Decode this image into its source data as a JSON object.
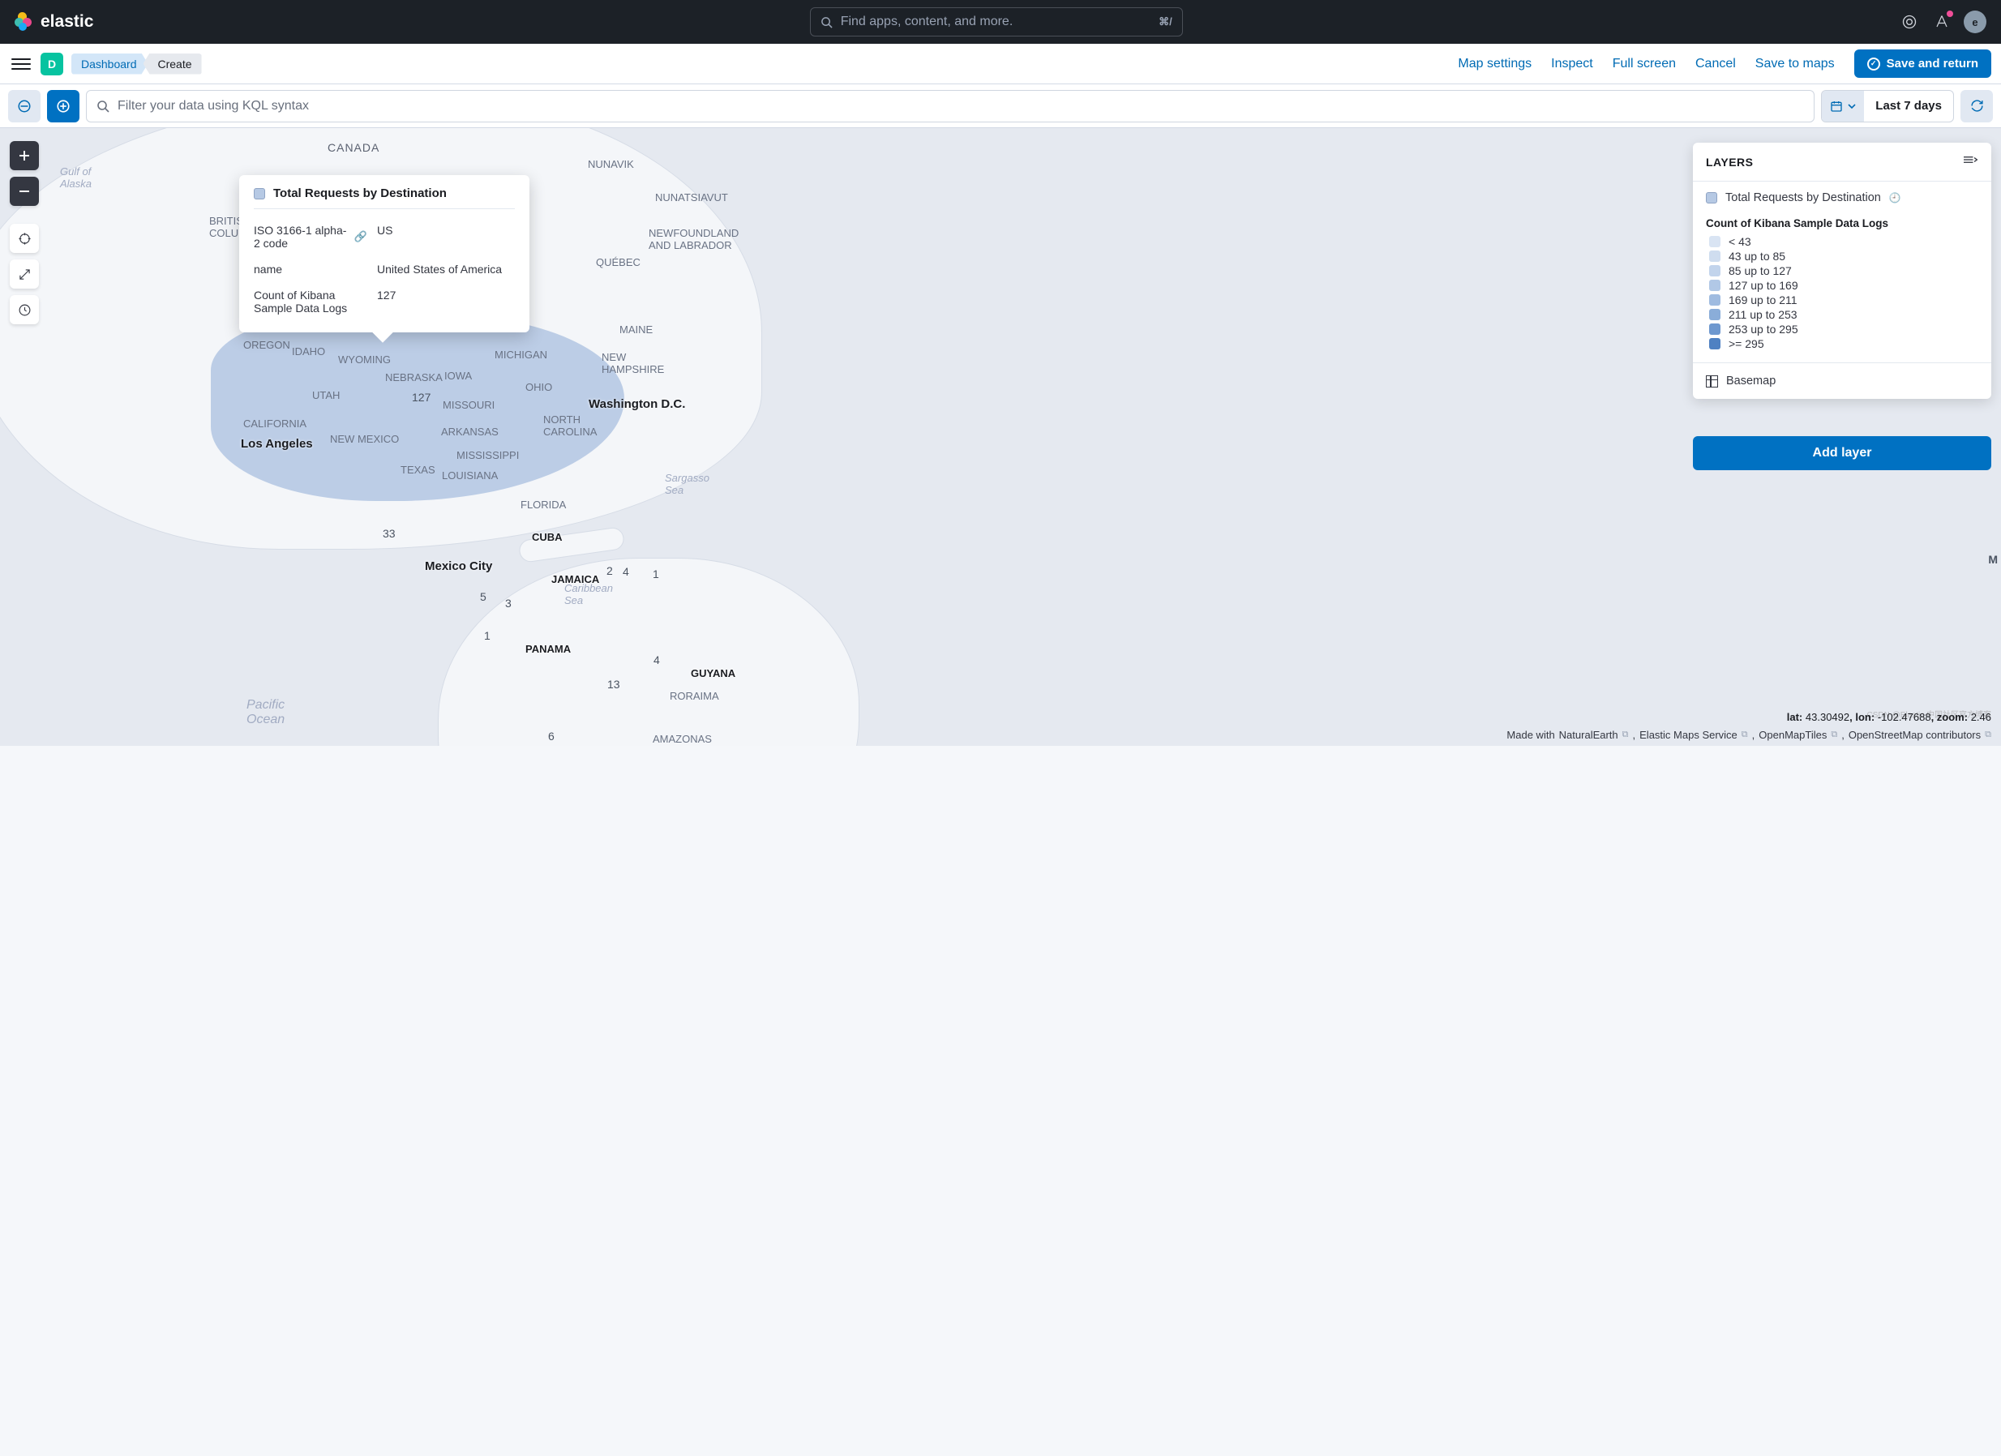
{
  "top": {
    "brand": "elastic",
    "search_placeholder": "Find apps, content, and more.",
    "shortcut": "⌘/",
    "avatar": "e"
  },
  "subbar": {
    "d_tag": "D",
    "crumbs": [
      "Dashboard",
      "Create"
    ],
    "links": [
      "Map settings",
      "Inspect",
      "Full screen",
      "Cancel",
      "Save to maps"
    ],
    "primary": "Save and return"
  },
  "query": {
    "placeholder": "Filter your data using KQL syntax",
    "timerange": "Last 7 days"
  },
  "tooltip": {
    "title": "Total Requests by Destination",
    "rows": [
      {
        "k": "ISO 3166-1 alpha-2 code",
        "v": "US",
        "link": true
      },
      {
        "k": "name",
        "v": "United States of America"
      },
      {
        "k": "Count of Kibana Sample Data Logs",
        "v": "127"
      }
    ]
  },
  "layers": {
    "title": "LAYERS",
    "item1": "Total Requests by Destination",
    "legend_title": "Count of Kibana Sample Data Logs",
    "legend": [
      {
        "c": "#d9e4f3",
        "t": "< 43"
      },
      {
        "c": "#cfddef",
        "t": "43 up to 85"
      },
      {
        "c": "#c2d4ec",
        "t": "85 up to 127"
      },
      {
        "c": "#b1c8e6",
        "t": "127 up to 169"
      },
      {
        "c": "#9fbbe0",
        "t": "169 up to 211"
      },
      {
        "c": "#8aadd9",
        "t": "211 up to 253"
      },
      {
        "c": "#6e98cf",
        "t": "253 up to 295"
      },
      {
        "c": "#4f81c2",
        "t": ">= 295"
      }
    ],
    "basemap": "Basemap",
    "add": "Add layer"
  },
  "map": {
    "labels": {
      "canada": "CANADA",
      "nunavik": "NUNAVIK",
      "nunatsiavut": "NUNATSIAVUT",
      "newfoundland": "NEWFOUNDLAND\nAND LABRADOR",
      "quebec": "QUÉBEC",
      "british_columbia": "BRITISH\nCOLUMB",
      "gulf_alaska": "Gulf of\nAlaska",
      "oregon": "OREGON",
      "idaho": "IDAHO",
      "wyoming": "WYOMING",
      "nebraska": "NEBRASKA",
      "iowa": "IOWA",
      "michigan": "MICHIGAN",
      "ohio": "OHIO",
      "maine": "MAINE",
      "new_hampshire": "NEW\nHAMPSHIRE",
      "utah": "UTAH",
      "california": "CALIFORNIA",
      "new_mexico": "NEW MEXICO",
      "missouri": "MISSOURI",
      "arkansas": "ARKANSAS",
      "north_carolina": "NORTH\nCAROLINA",
      "washington_dc": "Washington D.C.",
      "los_angeles": "Los Angeles",
      "texas": "TEXAS",
      "mississippi": "MISSISSIPPI",
      "louisiana": "LOUISIANA",
      "florida": "FLORIDA",
      "sargasso": "Sargasso\nSea",
      "mexico_city": "Mexico City",
      "cuba": "CUBA",
      "jamaica": "JAMAICA",
      "caribbean": "Caribbean\nSea",
      "panama": "PANAMA",
      "guyana": "GUYANA",
      "roraima": "RORAIMA",
      "amazonas": "AMAZONAS",
      "pacific": "Pacific\nOcean"
    },
    "values": {
      "us": "127",
      "mx": "33",
      "gt": "5",
      "hn": "3",
      "ni": "1",
      "cu": "2",
      "ht": "4",
      "do": "1",
      "pa": "4",
      "co": "13",
      "ve": "6",
      "m": "M"
    }
  },
  "status": {
    "lat_l": "lat: ",
    "lat": "43.30492",
    "lon_l": ", lon: ",
    "lon": "-102.47688",
    "zoom_l": ", zoom: ",
    "zoom": "2.46"
  },
  "attrib": {
    "prefix": "Made with ",
    "items": [
      "NaturalEarth",
      "Elastic Maps Service",
      "OpenMapTiles",
      "OpenStreetMap contributors"
    ]
  },
  "watermark": "CSDN @Elastic 中国社区官方博客"
}
